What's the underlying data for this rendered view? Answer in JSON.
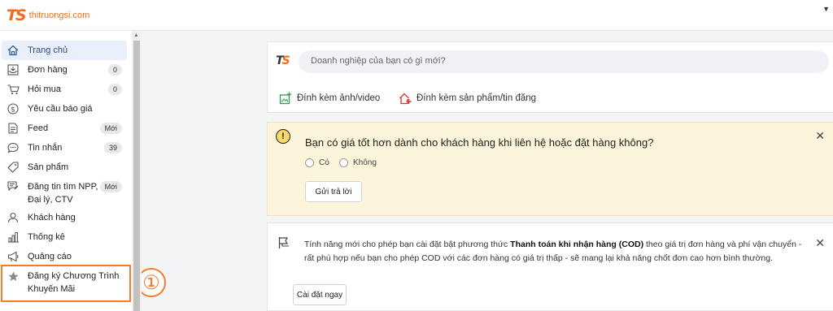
{
  "topbar": {
    "logo_mark": "TS",
    "logo_text": "thitruongsi.com"
  },
  "sidebar": {
    "items": [
      {
        "label": "Trang chủ",
        "icon": "home-icon",
        "badge": ""
      },
      {
        "label": "Đơn hàng",
        "icon": "inbox-download-icon",
        "badge": "0"
      },
      {
        "label": "Hỏi mua",
        "icon": "cart-icon",
        "badge": "0"
      },
      {
        "label": "Yêu cầu báo giá",
        "icon": "dollar-circle-icon",
        "badge": ""
      },
      {
        "label": "Feed",
        "icon": "document-icon",
        "badge": "Mới"
      },
      {
        "label": "Tin nhắn",
        "icon": "chat-bubble-icon",
        "badge": "39"
      },
      {
        "label": "Sản phẩm",
        "icon": "tag-icon",
        "badge": ""
      },
      {
        "label": "Đăng tin tìm NPP, Đại lý, CTV",
        "icon": "post-icon",
        "badge": "Mới"
      },
      {
        "label": "Khách hàng",
        "icon": "user-icon",
        "badge": ""
      },
      {
        "label": "Thống kê",
        "icon": "bar-chart-icon",
        "badge": ""
      },
      {
        "label": "Quảng cáo",
        "icon": "megaphone-icon",
        "badge": ""
      },
      {
        "label": "Đăng ký Chương Trình Khuyến Mãi",
        "icon": "star-icon",
        "badge": ""
      }
    ],
    "annotation": "①"
  },
  "post": {
    "placeholder": "Doanh nghiệp của bạn có gì mới?",
    "attach_media": "Đính kèm ảnh/video",
    "attach_product": "Đính kèm sản phẩm/tin đăng"
  },
  "question": {
    "icon": "warning-icon",
    "title": "Bạn có giá tốt hơn dành cho khách hàng khi liên hệ hoặc đặt hàng không?",
    "option_yes": "Có",
    "option_no": "Không",
    "submit": "Gửi trả lời",
    "close": "✕"
  },
  "cod": {
    "icon": "flag-icon",
    "text_before": "Tính năng mới cho phép bạn cài đặt bật phương thức ",
    "text_bold": "Thanh toán khi nhận hàng (COD)",
    "text_after": " theo giá trị đơn hàng và phí vận chuyển - rất phù hợp nếu bạn cho phép COD với các đơn hàng có giá trị thấp - sẽ mang lại khả năng chốt đơn cao hơn bình thường.",
    "button": "Cài đặt ngay",
    "close": "✕"
  },
  "colors": {
    "brand": "#f26b1d",
    "active_bg": "#eaf0fb",
    "notice_bg": "#fdf4dc",
    "annotation": "#f07c2d"
  }
}
